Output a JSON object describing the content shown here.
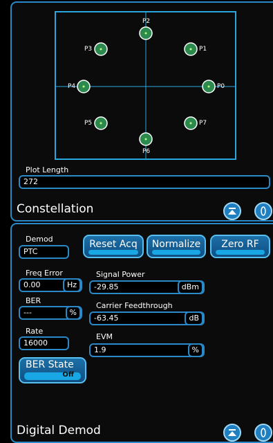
{
  "constellation": {
    "title": "Constellation",
    "plot_length_label": "Plot Length",
    "plot_length_value": "272",
    "points": [
      {
        "label": "P0"
      },
      {
        "label": "P1"
      },
      {
        "label": "P2"
      },
      {
        "label": "P3"
      },
      {
        "label": "P4"
      },
      {
        "label": "P5"
      },
      {
        "label": "P6"
      },
      {
        "label": "P7"
      }
    ]
  },
  "demod": {
    "title": "Digital Demod",
    "demod_label": "Demod",
    "demod_value": "PTC",
    "reset_acq": "Reset Acq",
    "normalize": "Normalize",
    "zero_rf": "Zero RF",
    "freq_error_label": "Freq Error",
    "freq_error_value": "0.00",
    "freq_error_unit": "Hz",
    "signal_power_label": "Signal Power",
    "signal_power_value": "-29.85",
    "signal_power_unit": "dBm",
    "ber_label": "BER",
    "ber_value": "---",
    "ber_unit": "%",
    "carrier_label": "Carrier Feedthrough",
    "carrier_value": "-63.45",
    "carrier_unit": "dB",
    "rate_label": "Rate",
    "rate_value": "16000",
    "evm_label": "EVM",
    "evm_value": "1.9",
    "evm_unit": "%",
    "ber_state_label": "BER State",
    "ber_state_value": "Off"
  },
  "colors": {
    "accent": "#2a89c8",
    "point": "#2d8a4e",
    "axis": "#29a8e0"
  }
}
